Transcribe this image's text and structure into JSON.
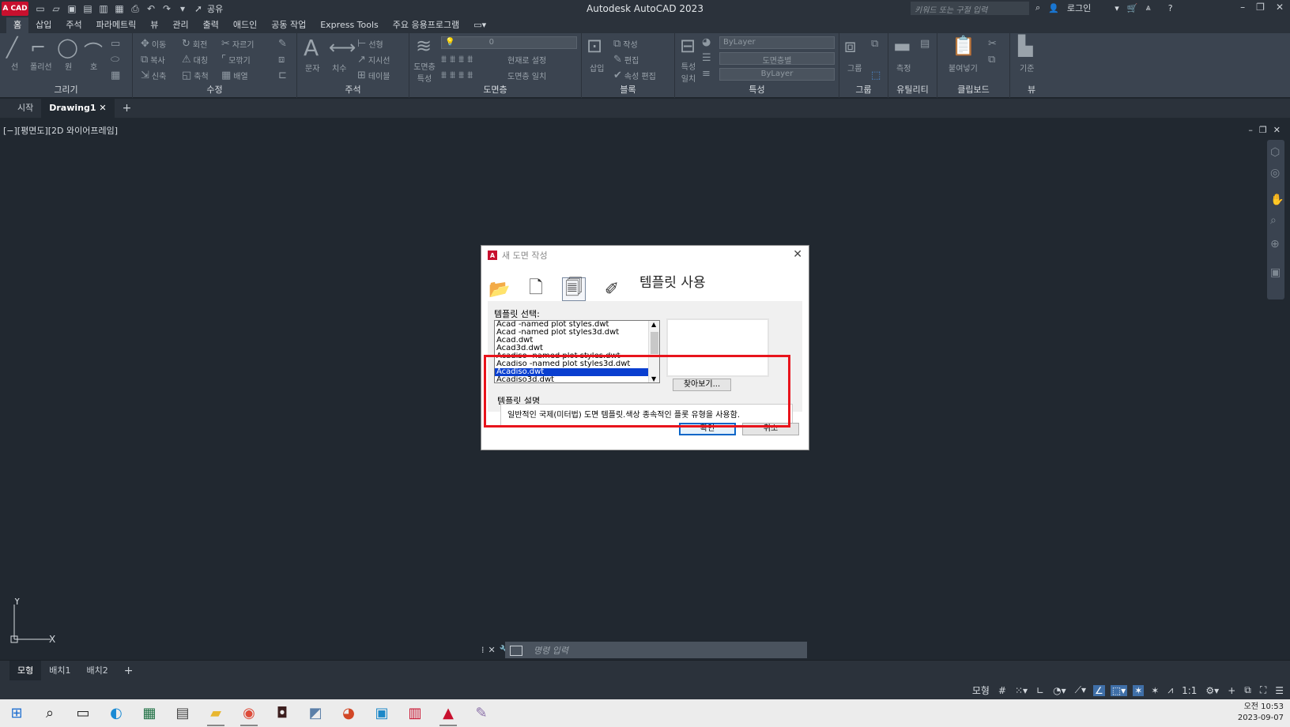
{
  "app": {
    "logo": "A CAD",
    "title": "Autodesk AutoCAD 2023",
    "share_label": "공유",
    "search_placeholder": "키워드 또는 구절 입력",
    "login_label": "로그인"
  },
  "ribbon_tabs": [
    "홈",
    "삽입",
    "주석",
    "파라메트릭",
    "뷰",
    "관리",
    "출력",
    "애드인",
    "공동 작업",
    "Express Tools",
    "주요 응용프로그램"
  ],
  "ribbon_panels": {
    "draw": {
      "title": "그리기",
      "tools": [
        "선",
        "폴리선",
        "원",
        "호"
      ]
    },
    "modify": {
      "title": "수정",
      "tools": [
        "이동",
        "회전",
        "자르기",
        "복사",
        "대칭",
        "모깎기",
        "신축",
        "축척",
        "배열"
      ]
    },
    "annotation": {
      "title": "주석",
      "tools": [
        "문자",
        "치수",
        "선형",
        "지시선",
        "테이블"
      ]
    },
    "layers": {
      "title": "도면층",
      "tools": [
        "도면층 특성",
        "현재로 설정",
        "도면층 일치"
      ],
      "layer_value": "0"
    },
    "block": {
      "title": "블록",
      "tools": [
        "삽입",
        "작성",
        "편집",
        "속성 편집"
      ]
    },
    "properties": {
      "title": "특성",
      "tools": [
        "특성 일치"
      ],
      "color": "ByLayer",
      "linetype": "도면층별",
      "lineweight": "ByLayer"
    },
    "groups": {
      "title": "그룹",
      "tools": [
        "그룹"
      ]
    },
    "utilities": {
      "title": "유틸리티",
      "tools": [
        "측정"
      ]
    },
    "clipboard": {
      "title": "클립보드",
      "tools": [
        "붙여넣기"
      ]
    },
    "view": {
      "title": "뷰",
      "tools": [
        "기준"
      ]
    }
  },
  "file_tabs": [
    "시작",
    "Drawing1"
  ],
  "viewport_label": "[−][평면도][2D 와이어프레임]",
  "ucs": {
    "x": "X",
    "y": "Y"
  },
  "command_line": {
    "placeholder": "명령 입력"
  },
  "layout_tabs": [
    "모형",
    "배치1",
    "배치2"
  ],
  "status_bar": {
    "model_label": "모형",
    "scale": "1:1"
  },
  "dialog": {
    "title": "새 도면 작성",
    "heading": "템플릿 사용",
    "template_select_label": "템플릿 선택:",
    "templates": [
      "Acad -named plot styles.dwt",
      "Acad -named plot styles3d.dwt",
      "Acad.dwt",
      "Acad3d.dwt",
      "Acadiso -named plot styles.dwt",
      "Acadiso -named plot styles3d.dwt",
      "Acadiso.dwt",
      "Acadiso3d.dwt"
    ],
    "selected_index": 6,
    "browse_label": "찾아보기...",
    "description_label": "템플릿 설명",
    "description": "일반적인 국제(미터법) 도면 템플릿.색상 종속적인 플롯 유형을 사용함.",
    "ok_label": "확인",
    "cancel_label": "취소"
  },
  "clock": {
    "time": "오전 10:53",
    "date": "2023-09-07"
  },
  "colors": {
    "highlight": "#e8141c",
    "selection": "#0a3fd0",
    "background": "#212830"
  }
}
